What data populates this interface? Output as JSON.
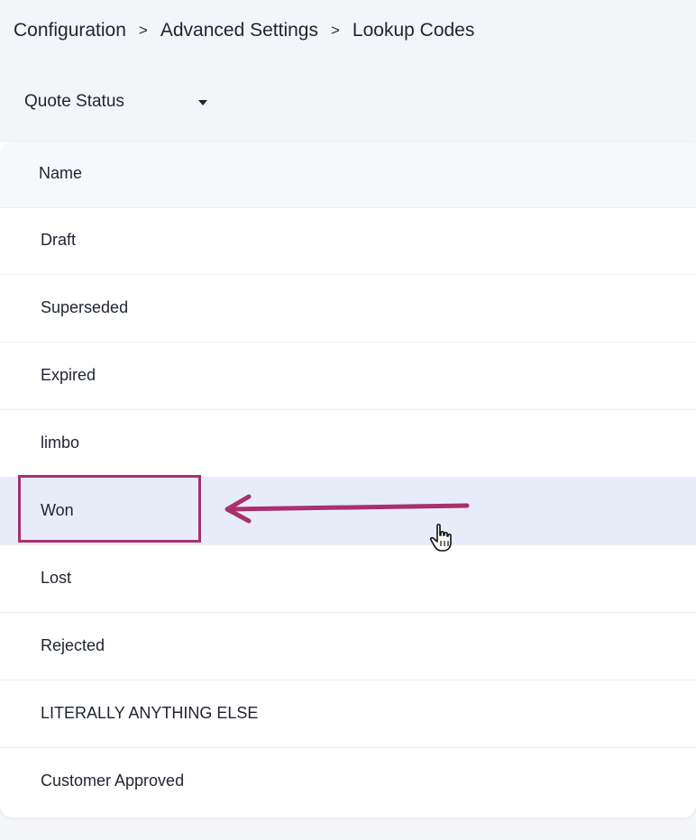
{
  "breadcrumb": {
    "items": [
      "Configuration",
      "Advanced Settings",
      "Lookup Codes"
    ],
    "separator": ">"
  },
  "lookup_type_select": {
    "selected": "Quote Status"
  },
  "table": {
    "columns": [
      "Name"
    ],
    "rows": [
      "Draft",
      "Superseded",
      "Expired",
      "limbo",
      "Won",
      "Lost",
      "Rejected",
      "LITERALLY ANYTHING ELSE",
      "Customer Approved"
    ]
  },
  "annotation": {
    "color": "#a8306e"
  },
  "colors": {
    "page_bg": "#f4f5f9",
    "hover_row_bg": "#e6edf8",
    "text": "#1f2430"
  },
  "icons": {
    "caret": "caret-down-icon",
    "separator": "chevron-right-icon",
    "cursor": "hand-pointer-icon",
    "arrow": "arrow-left-icon"
  }
}
